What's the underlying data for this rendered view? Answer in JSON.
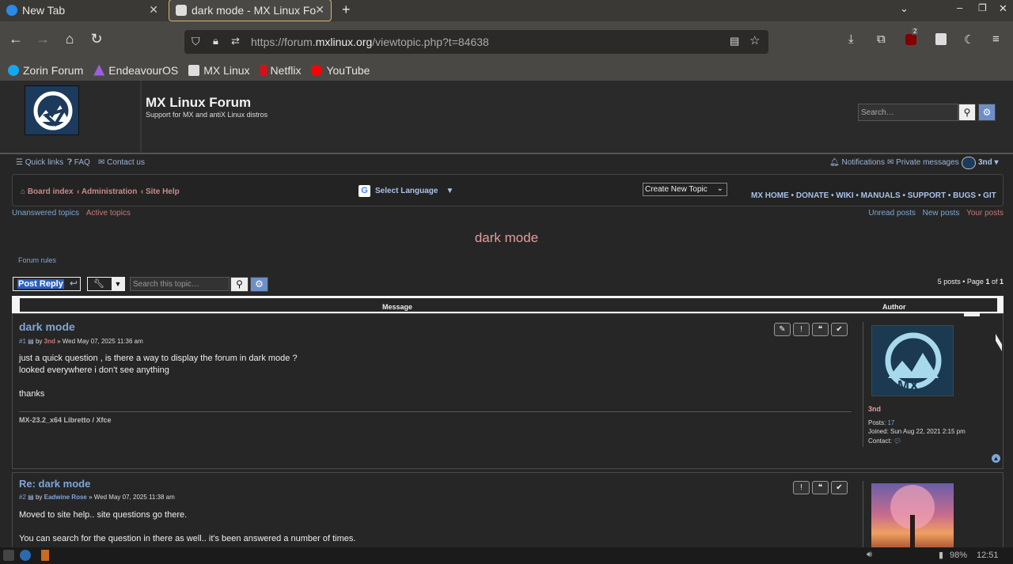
{
  "browser": {
    "tabs": [
      {
        "title": "New Tab",
        "active": false
      },
      {
        "title": "dark mode - MX Linux For",
        "active": true
      }
    ],
    "url": {
      "prefix": "https://forum.",
      "domain": "mxlinux.org",
      "path": "/viewtopic.php?t=84638"
    },
    "extension_badge": "2",
    "bookmarks": [
      {
        "label": "Zorin Forum",
        "color": "#15a6f0"
      },
      {
        "label": "EndeavourOS",
        "color": "#9b5fe0"
      },
      {
        "label": "MX Linux",
        "color": "#dddddd"
      },
      {
        "label": "Netflix",
        "color": "#e50914"
      },
      {
        "label": "YouTube",
        "color": "#ff0000"
      }
    ]
  },
  "header": {
    "site_name": "MX Linux Forum",
    "site_desc": "Support for MX and antiX Linux distros",
    "search_placeholder": "Search…"
  },
  "topnav": {
    "quick_links": "Quick links",
    "faq": "FAQ",
    "contact": "Contact us",
    "notifications": "Notifications",
    "private_messages": "Private messages",
    "user": "3nd"
  },
  "navbar": {
    "breadcrumbs": [
      "Board index",
      "Administration",
      "Site Help"
    ],
    "select_language": "Select Language",
    "create_topic": "Create New Topic",
    "mx_links": [
      "MX HOME",
      "DONATE",
      "WIKI",
      "MANUALS",
      "SUPPORT",
      "BUGS",
      "GIT"
    ]
  },
  "sublinks": {
    "left": [
      "Unanswered topics",
      "Active topics"
    ],
    "right": [
      "Unread posts",
      "New posts",
      "Your posts"
    ]
  },
  "topic": {
    "title": "dark mode",
    "forum_rules": "Forum rules",
    "post_reply": "Post Reply",
    "search_topic_placeholder": "Search this topic…",
    "pagination": {
      "prefix": "5 posts • Page ",
      "page": "1",
      "of": " of ",
      "total": "1"
    },
    "col_message": "Message",
    "col_author": "Author"
  },
  "posts": [
    {
      "title": "dark mode",
      "num": "#1",
      "by": "by",
      "author": "3nd",
      "date": "» Wed May 07, 2025 11:36 am",
      "lines": [
        "just a quick question , is there a way to display the forum in dark mode ?",
        "looked everywhere i don't see anything",
        "",
        "thanks"
      ],
      "signature": "MX-23.2_x64 Libretto / Xfce",
      "profile": {
        "name": "3nd",
        "posts_label": "Posts:",
        "posts": "17",
        "joined": "Joined: Sun Aug 22, 2021 2:15 pm",
        "contact": "Contact:"
      }
    },
    {
      "title": "Re: dark mode",
      "num": "#2",
      "by": "by",
      "author": "Eadwine Rose",
      "date": "» Wed May 07, 2025 11:38 am",
      "lines": [
        "Moved to site help.. site questions go there.",
        "",
        "You can search for the question in there as well.. it's been answered a number of times."
      ]
    }
  ],
  "taskbar": {
    "battery": "98%",
    "time": "12:51"
  },
  "colors": {
    "link": "#7fa6d9",
    "crumb": "#c98a8a",
    "title": "#e79b9b"
  }
}
